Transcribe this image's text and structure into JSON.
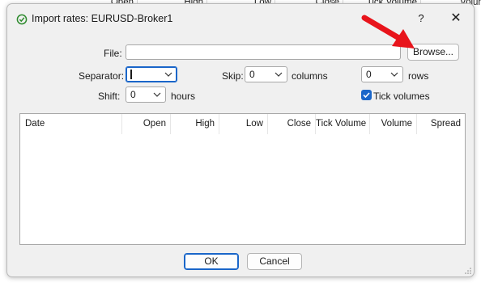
{
  "background_table": {
    "columns": [
      "Open",
      "High",
      "Low",
      "Close",
      "Tick Volume",
      "Volum"
    ]
  },
  "dialog": {
    "title": "Import rates: EURUSD-Broker1",
    "help_label": "?",
    "close_label": "✕"
  },
  "form": {
    "file_label": "File:",
    "file_value": "",
    "browse_label": "Browse...",
    "separator_label": "Separator:",
    "separator_value": "",
    "skip_label": "Skip:",
    "skip_value": "0",
    "columns_label": "columns",
    "rows_value": "0",
    "rows_label": "rows",
    "shift_label": "Shift:",
    "shift_value": "0",
    "hours_label": "hours",
    "tick_volumes_label": "Tick volumes",
    "tick_volumes_checked": true
  },
  "table": {
    "columns": [
      "Date",
      "Open",
      "High",
      "Low",
      "Close",
      "Tick Volume",
      "Volume",
      "Spread"
    ],
    "rows": []
  },
  "buttons": {
    "ok_label": "OK",
    "cancel_label": "Cancel"
  },
  "colors": {
    "accent": "#1a66c9",
    "annotation_arrow": "#e8141b",
    "dialog_bg": "#f0f0f0"
  },
  "icons": {
    "title": "import-rates-icon",
    "chevron": "chevron-down-icon",
    "check": "checkmark-icon",
    "grip": "resize-grip-icon",
    "annotation": "red-arrow-annotation"
  }
}
